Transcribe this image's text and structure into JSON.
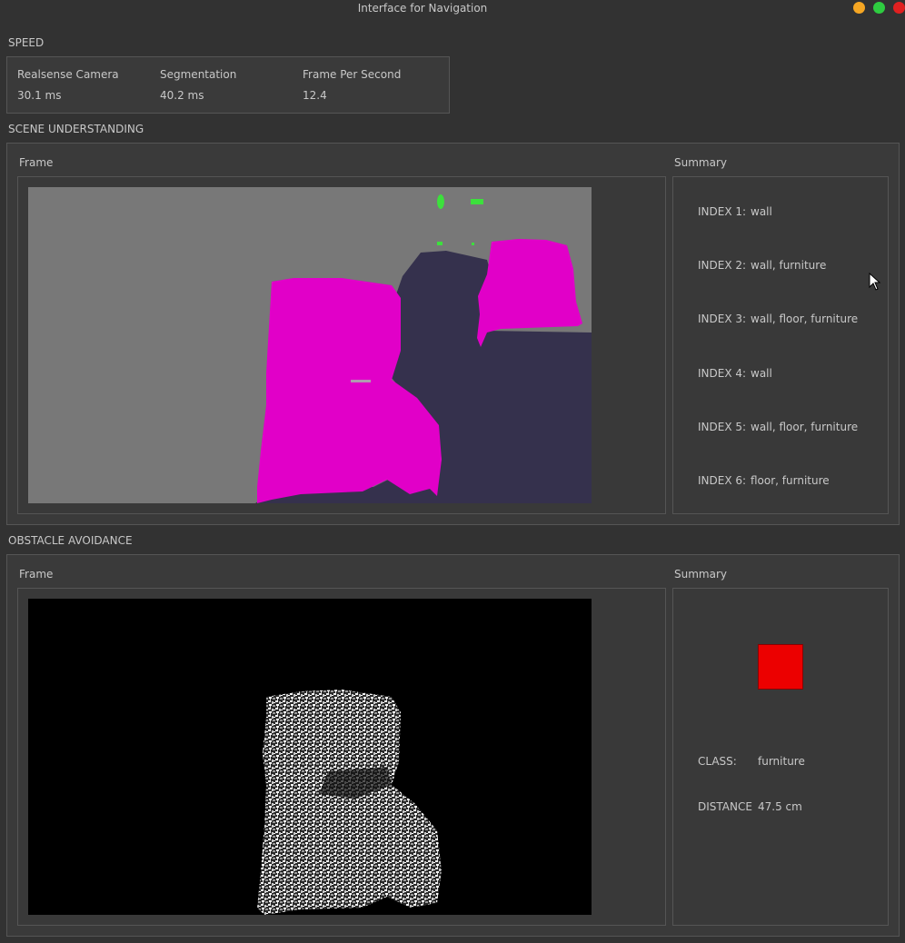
{
  "window": {
    "title": "Interface for Navigation",
    "controls": {
      "minimize_color": "#f5a623",
      "maximize_color": "#2ecc40",
      "close_color": "#e02020"
    }
  },
  "speed": {
    "section_label": "SPEED",
    "metrics": [
      {
        "label": "Realsense Camera",
        "value": "30.1 ms"
      },
      {
        "label": "Segmentation",
        "value": "40.2 ms"
      },
      {
        "label": "Frame Per Second",
        "value": "12.4"
      }
    ]
  },
  "scene": {
    "section_label": "SCENE UNDERSTANDING",
    "frame_label": "Frame",
    "summary_label": "Summary",
    "indices": [
      {
        "key": "INDEX 1:",
        "value": "wall"
      },
      {
        "key": "INDEX 2:",
        "value": "wall, furniture"
      },
      {
        "key": "INDEX 3:",
        "value": "wall, floor, furniture"
      },
      {
        "key": "INDEX 4:",
        "value": "wall"
      },
      {
        "key": "INDEX 5:",
        "value": "wall, floor, furniture"
      },
      {
        "key": "INDEX 6:",
        "value": "floor, furniture"
      }
    ],
    "colors": {
      "wall": "#787878",
      "furniture": "#e100c8",
      "floor": "#35314d",
      "plant": "#3ce03c"
    }
  },
  "obstacle": {
    "section_label": "OBSTACLE AVOIDANCE",
    "frame_label": "Frame",
    "summary_label": "Summary",
    "indicator_color": "#ec0000",
    "class_key": "CLASS:",
    "class_value": "furniture",
    "distance_key": "DISTANCE",
    "distance_value": "47.5 cm"
  }
}
